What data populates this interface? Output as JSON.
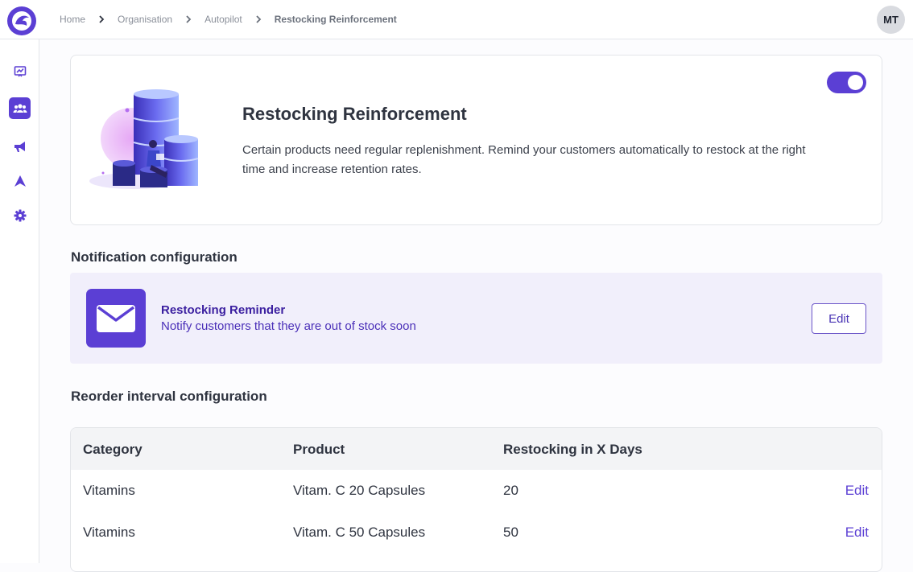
{
  "breadcrumb": {
    "items": [
      "Home",
      "Organisation",
      "Autopilot"
    ],
    "current": "Restocking Reinforcement"
  },
  "user": {
    "initials": "MT"
  },
  "sidebar": {
    "items": [
      {
        "icon": "chart-icon",
        "active": false
      },
      {
        "icon": "users-icon",
        "active": true
      },
      {
        "icon": "megaphone-icon",
        "active": false
      },
      {
        "icon": "autopilot-icon",
        "active": false
      },
      {
        "icon": "gear-icon",
        "active": false
      }
    ]
  },
  "hero": {
    "title": "Restocking Reinforcement",
    "description": "Certain products need regular replenishment. Remind your customers automatically to restock at the right time and increase retention rates.",
    "enabled": true
  },
  "notification_section": {
    "title": "Notification configuration",
    "item": {
      "title": "Restocking Reminder",
      "subtitle": "Notify customers that they are out of stock soon",
      "edit_label": "Edit"
    }
  },
  "reorder_section": {
    "title": "Reorder interval configuration",
    "columns": [
      "Category",
      "Product",
      "Restocking in X Days"
    ],
    "rows": [
      {
        "category": "Vitamins",
        "product": "Vitam. C 20 Capsules",
        "days": "20",
        "edit_label": "Edit"
      },
      {
        "category": "Vitamins",
        "product": "Vitam. C 50 Capsules",
        "days": "50",
        "edit_label": "Edit"
      }
    ]
  },
  "colors": {
    "accent": "#5b3fd4",
    "notification_bg": "#f1effb"
  }
}
